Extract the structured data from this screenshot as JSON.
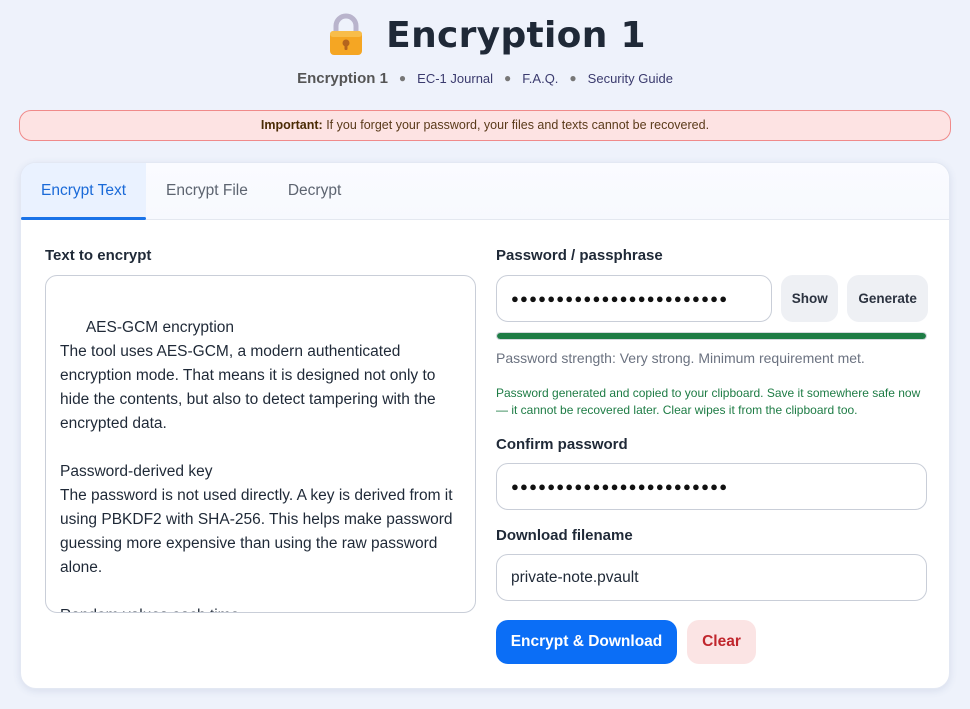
{
  "header": {
    "title": "Encryption 1",
    "icon": "lock-icon",
    "nav": {
      "brand": "Encryption 1",
      "links": [
        "EC-1 Journal",
        "F.A.Q.",
        "Security Guide"
      ]
    }
  },
  "alert": {
    "strong": "Important:",
    "text": " If you forget your password, your files and texts cannot be recovered."
  },
  "tabs": [
    {
      "label": "Encrypt Text",
      "active": true
    },
    {
      "label": "Encrypt File",
      "active": false
    },
    {
      "label": "Decrypt",
      "active": false
    }
  ],
  "text_section": {
    "label": "Text to encrypt",
    "value": "AES-GCM encryption\nThe tool uses AES-GCM, a modern authenticated encryption mode. That means it is designed not only to hide the contents, but also to detect tampering with the encrypted data.\n\nPassword-derived key\nThe password is not used directly. A key is derived from it using PBKDF2 with SHA-256. This helps make password guessing more expensive than using the raw password alone.\n\nRandom values each time\nThe tool generates a fresh salt and IV for every"
  },
  "password": {
    "label": "Password / passphrase",
    "masked_value": "●●●●●●●●●●●●●●●●●●●●●●●●",
    "show_label": "Show",
    "generate_label": "Generate",
    "strength_fraction": 1.0,
    "strength_color": "#1e7c45",
    "strength_text": "Password strength: Very strong. Minimum requirement met.",
    "generated_note": "Password generated and copied to your clipboard. Save it somewhere safe now — it cannot be recovered later. Clear wipes it from the clipboard too."
  },
  "confirm": {
    "label": "Confirm password",
    "masked_value": "●●●●●●●●●●●●●●●●●●●●●●●●"
  },
  "filename": {
    "label": "Download filename",
    "value": "private-note.pvault"
  },
  "actions": {
    "encrypt_label": "Encrypt & Download",
    "clear_label": "Clear"
  },
  "colors": {
    "accent": "#0b6ef6",
    "tab_active": "#1a6ad8",
    "danger": "#c0262d",
    "success": "#1e7c45"
  }
}
